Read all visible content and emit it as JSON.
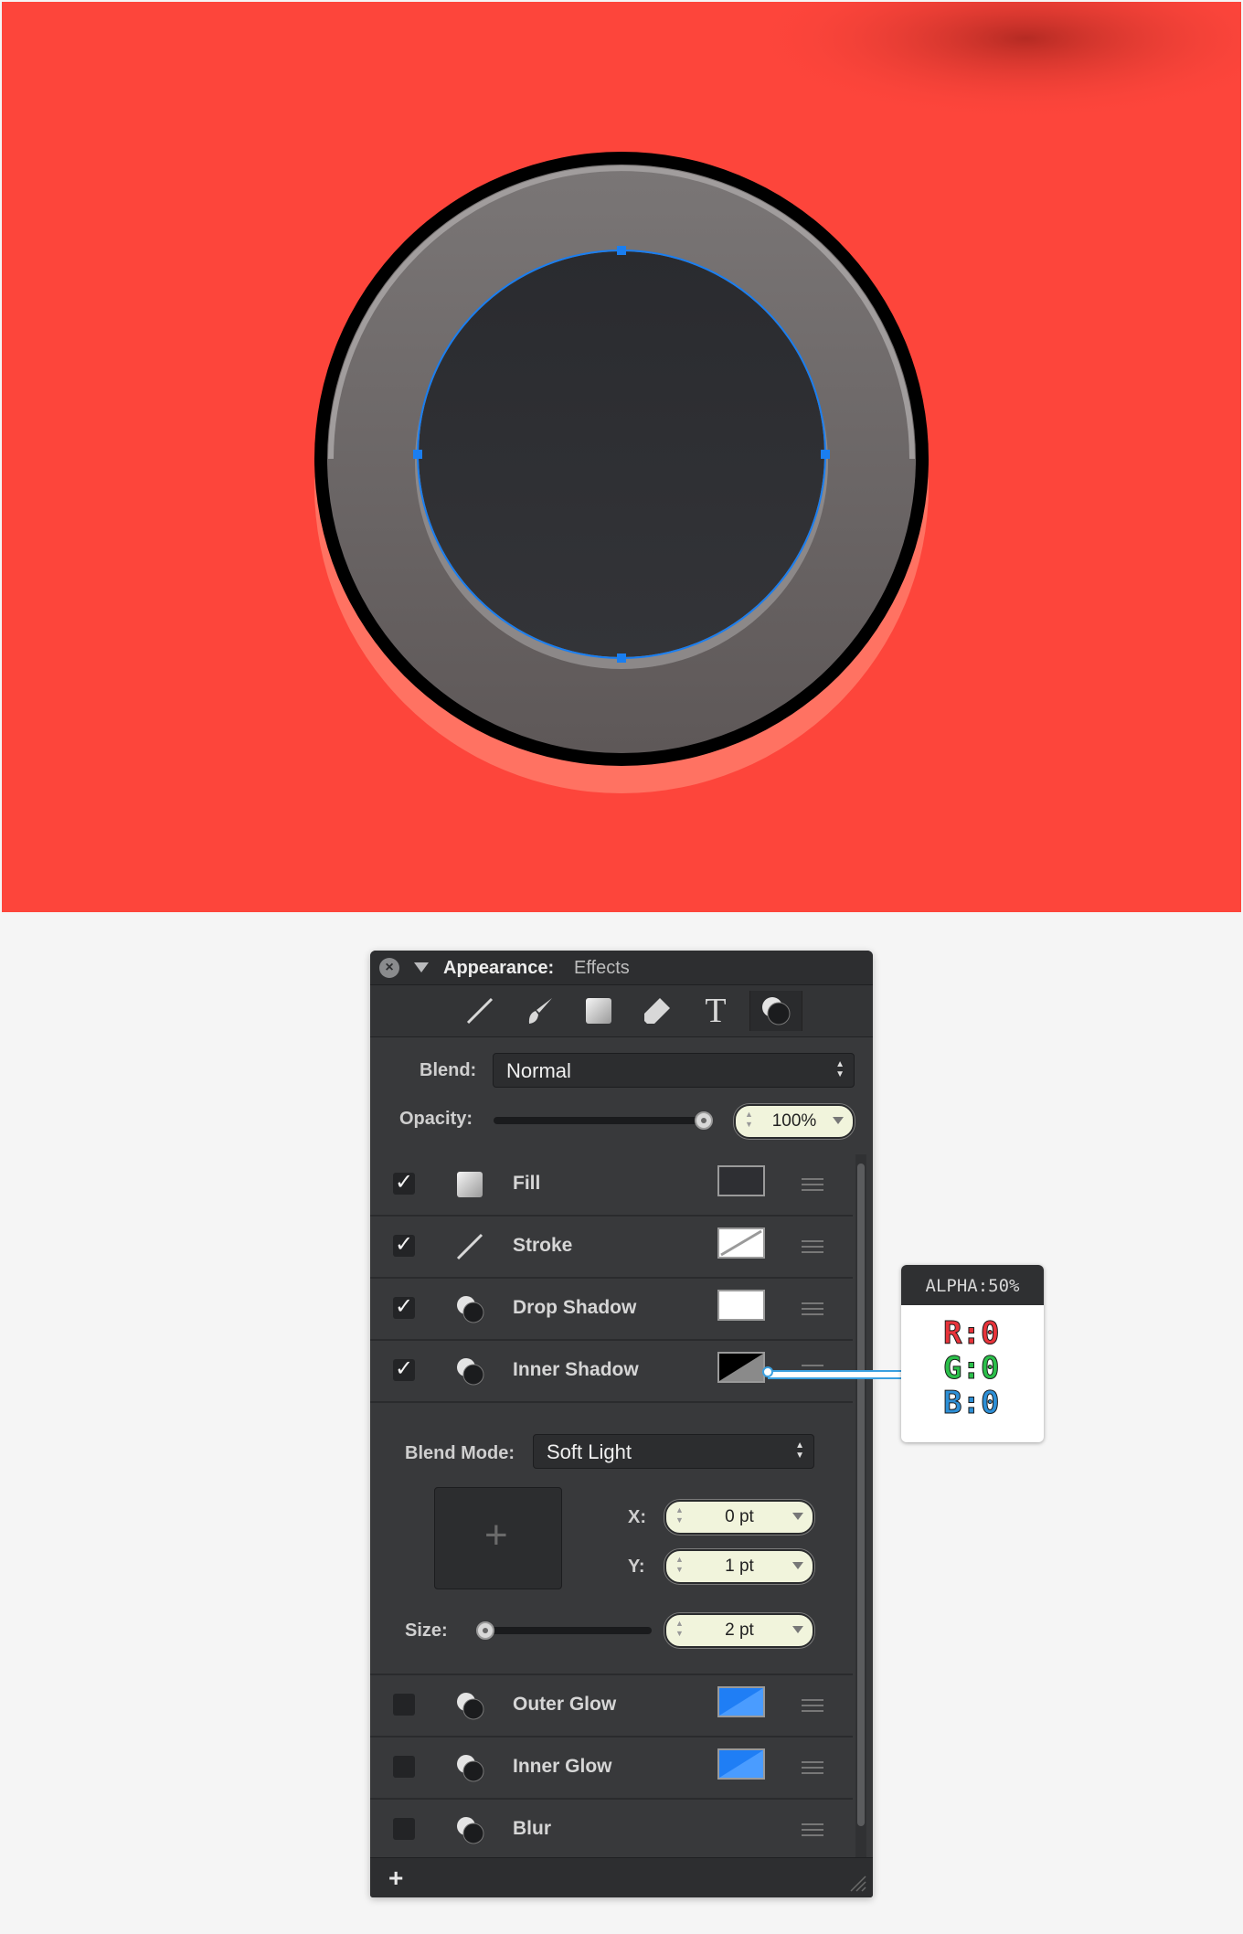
{
  "colors": {
    "canvas_bg": "#fd453b",
    "ring_outline": "#000000",
    "ring_gray": "#6f6a6a",
    "inner_circle": "#2e2f33",
    "selection_blue": "#1a7ef0",
    "shadow_pink": "#ff7262",
    "panel_bg": "#38393b",
    "pill_bg": "#f1f4dc"
  },
  "panel": {
    "title": "Appearance:",
    "subtitle": "Effects",
    "toolbar_icons": [
      "line-icon",
      "brush-icon",
      "fill-icon",
      "eraser-icon",
      "text-icon",
      "effects-icon"
    ],
    "blend_label": "Blend:",
    "blend_value": "Normal",
    "opacity_label": "Opacity:",
    "opacity_value": "100%",
    "opacity_fraction": 1.0,
    "rows": [
      {
        "label": "Fill",
        "checked": true,
        "check": "✓",
        "icon": "gradient-icon",
        "swatch": "dark"
      },
      {
        "label": "Stroke",
        "checked": true,
        "check": "✓",
        "icon": "line-icon",
        "swatch": "none"
      },
      {
        "label": "Drop Shadow",
        "checked": true,
        "check": "✓",
        "icon": "shadow-icon",
        "swatch": "white"
      },
      {
        "label": "Inner Shadow",
        "checked": true,
        "check": "✓",
        "icon": "shadow-icon",
        "swatch": "black-half"
      },
      {
        "label": "Outer Glow",
        "checked": false,
        "check": "",
        "icon": "shadow-icon",
        "swatch": "blue"
      },
      {
        "label": "Inner Glow",
        "checked": false,
        "check": "",
        "icon": "shadow-icon",
        "swatch": "blue"
      },
      {
        "label": "Blur",
        "checked": false,
        "check": "",
        "icon": "shadow-icon",
        "swatch": "none-hidden"
      }
    ],
    "inner_shadow": {
      "blend_mode_label": "Blend Mode:",
      "blend_mode_value": "Soft Light",
      "x_label": "X:",
      "x_value": "0 pt",
      "y_label": "Y:",
      "y_value": "1 pt",
      "size_label": "Size:",
      "size_value": "2 pt"
    },
    "add_label": "+"
  },
  "color_callout": {
    "alpha": "ALPHA:50%",
    "r": "R:0",
    "g": "G:0",
    "b": "B:0",
    "r_color": "#e8333a",
    "g_color": "#2bbf4a",
    "b_color": "#2d8fd6"
  }
}
